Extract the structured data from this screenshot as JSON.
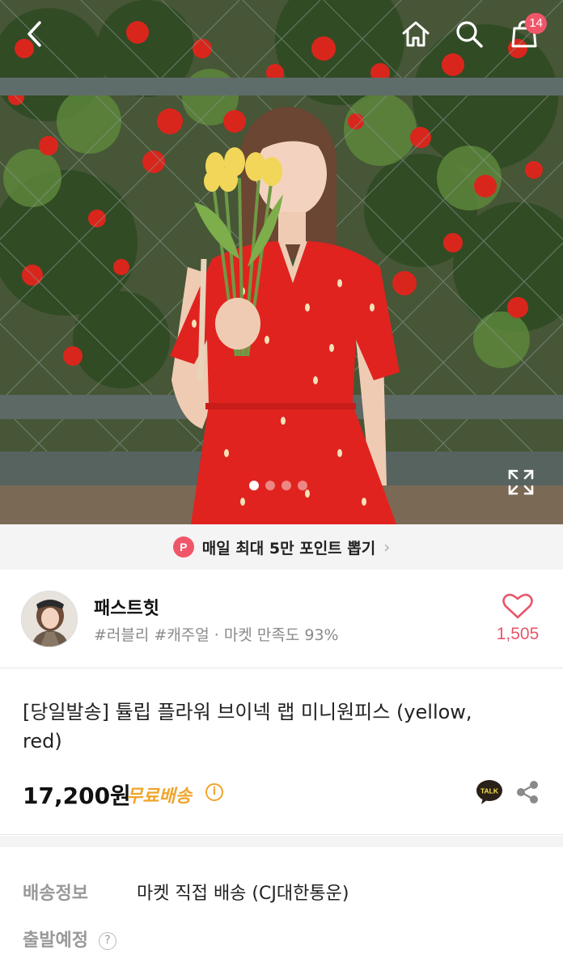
{
  "header": {
    "icons": [
      "back-icon",
      "home-icon",
      "search-icon",
      "cart-icon"
    ],
    "cart_count": "14"
  },
  "gallery": {
    "dots_total": 4,
    "active_index": 0
  },
  "point_banner": {
    "badge": "P",
    "text": "매일 최대 5만 포인트 뽑기",
    "chevron": "›"
  },
  "shop": {
    "name": "패스트힛",
    "meta": "#러블리 #캐주얼 · 마켓 만족도 93%",
    "likes": "1,505"
  },
  "product": {
    "title": "[당일발송] 튤립 플라워 브이넥 랩 미니원피스 (yellow, red)",
    "price": "17,200원",
    "free_shipping": "무료배송",
    "info_mark": "i",
    "talk_label": "TALK"
  },
  "shipping": {
    "info_label": "배송정보",
    "info_value": "마켓 직접 배송 (CJ대한통운)",
    "depart_label": "출발예정",
    "help_mark": "?"
  },
  "colors": {
    "accent_pink": "#f0566a",
    "free_ship_orange": "#f0a52c",
    "like_red": "#e8566a"
  }
}
